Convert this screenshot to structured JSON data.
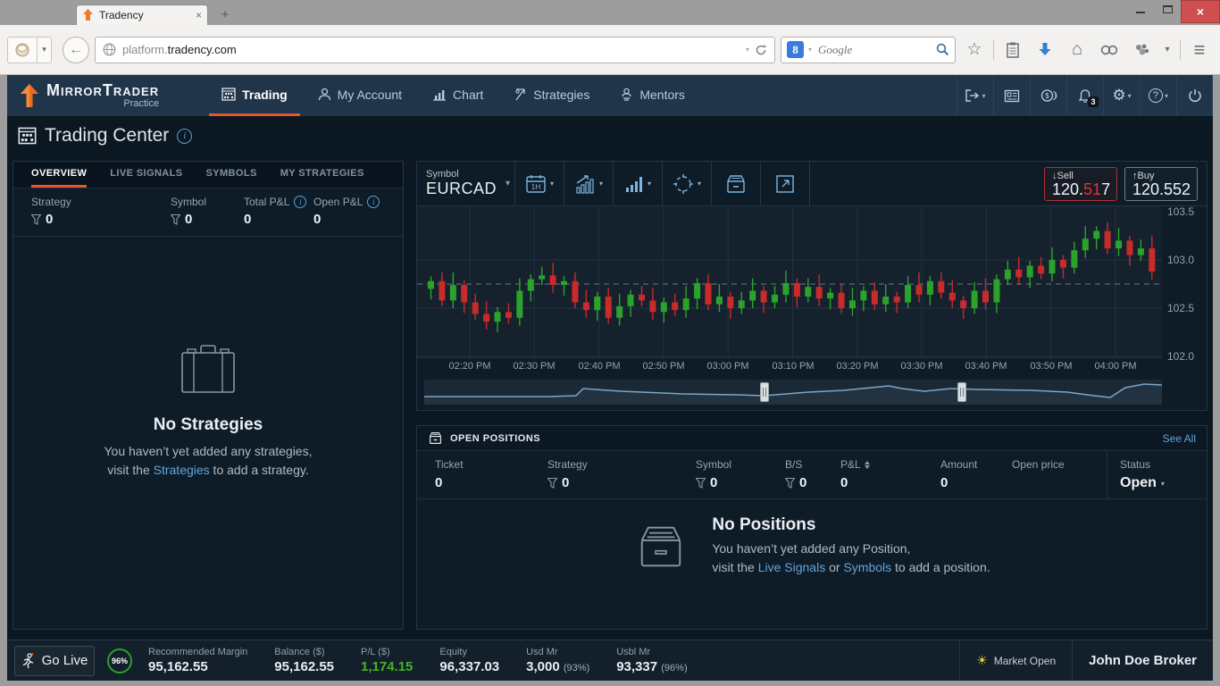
{
  "glyphs": {
    "dropdown": "▾",
    "plus": "+",
    "close_x": "×",
    "back_arrow": "←",
    "star": "☆",
    "home": "⌂",
    "gear": "⚙",
    "question": "?",
    "info": "i",
    "sun": "☀",
    "sell_arrow": "↓",
    "buy_arrow": "↑",
    "hamburger": "≡",
    "search_engine_initial": "8"
  },
  "browser": {
    "tab_title": "Tradency",
    "url_prefix": "platform.",
    "url_domain": "tradency.com",
    "search_placeholder": "Google"
  },
  "nav": {
    "brand": "MirrorTrader",
    "brand_sub": "Practice",
    "items": [
      {
        "label": "Trading"
      },
      {
        "label": "My Account"
      },
      {
        "label": "Chart"
      },
      {
        "label": "Strategies"
      },
      {
        "label": "Mentors"
      }
    ],
    "bell_badge": "3"
  },
  "page": {
    "title": "Trading Center"
  },
  "left_panel": {
    "tabs": [
      "OVERVIEW",
      "LIVE SIGNALS",
      "SYMBOLS",
      "MY STRATEGIES"
    ],
    "stats": [
      {
        "label": "Strategy",
        "value": "0"
      },
      {
        "label": "Symbol",
        "value": "0"
      },
      {
        "label": "Total P&L",
        "value": "0"
      },
      {
        "label": "Open P&L",
        "value": "0"
      }
    ],
    "empty": {
      "title": "No Strategies",
      "line1": "You haven’t yet added any strategies,",
      "line2_pre": "visit the ",
      "line2_link": "Strategies",
      "line2_post": " to add a strategy."
    }
  },
  "chart_panel": {
    "symbol_label": "Symbol",
    "symbol": "EURCAD",
    "timeframe": "1H",
    "sell": {
      "label": "Sell",
      "price_pre": "120.",
      "price_mid": "51",
      "price_post": "7"
    },
    "buy": {
      "label": "Buy",
      "price": "120.552"
    }
  },
  "chart_data": {
    "type": "candlestick",
    "symbol": "EURCAD",
    "timeframe": "1H",
    "ylim": [
      102.0,
      103.5
    ],
    "y_ticks": [
      "103.5",
      "103.0",
      "102.5",
      "102.0"
    ],
    "dashed_level": 102.75,
    "x_labels": [
      "02:20 PM",
      "02:30 PM",
      "02:40 PM",
      "02:50 PM",
      "03:00 PM",
      "03:10 PM",
      "03:20 PM",
      "03:30 PM",
      "03:40 PM",
      "03:50 PM",
      "04:00 PM"
    ],
    "candles": [
      [
        102.7,
        102.83,
        102.59,
        102.78
      ],
      [
        102.78,
        102.87,
        102.52,
        102.58
      ],
      [
        102.58,
        102.87,
        102.5,
        102.74
      ],
      [
        102.74,
        102.79,
        102.45,
        102.56
      ],
      [
        102.56,
        102.65,
        102.38,
        102.44
      ],
      [
        102.44,
        102.57,
        102.28,
        102.36
      ],
      [
        102.36,
        102.51,
        102.25,
        102.46
      ],
      [
        102.46,
        102.55,
        102.34,
        102.4
      ],
      [
        102.4,
        102.81,
        102.32,
        102.68
      ],
      [
        102.68,
        102.85,
        102.57,
        102.8
      ],
      [
        102.8,
        102.93,
        102.74,
        102.84
      ],
      [
        102.84,
        102.97,
        102.66,
        102.74
      ],
      [
        102.74,
        102.83,
        102.63,
        102.78
      ],
      [
        102.78,
        102.87,
        102.5,
        102.56
      ],
      [
        102.56,
        102.69,
        102.4,
        102.48
      ],
      [
        102.48,
        102.67,
        102.37,
        102.62
      ],
      [
        102.62,
        102.71,
        102.34,
        102.4
      ],
      [
        102.4,
        102.65,
        102.32,
        102.52
      ],
      [
        102.52,
        102.69,
        102.41,
        102.64
      ],
      [
        102.64,
        102.73,
        102.52,
        102.58
      ],
      [
        102.58,
        102.71,
        102.38,
        102.46
      ],
      [
        102.46,
        102.61,
        102.35,
        102.56
      ],
      [
        102.56,
        102.65,
        102.42,
        102.48
      ],
      [
        102.48,
        102.73,
        102.4,
        102.6
      ],
      [
        102.6,
        102.81,
        102.49,
        102.76
      ],
      [
        102.76,
        102.85,
        102.48,
        102.54
      ],
      [
        102.54,
        102.75,
        102.46,
        102.62
      ],
      [
        102.62,
        102.67,
        102.39,
        102.5
      ],
      [
        102.5,
        102.67,
        102.44,
        102.58
      ],
      [
        102.58,
        102.81,
        102.5,
        102.68
      ],
      [
        102.68,
        102.73,
        102.45,
        102.56
      ],
      [
        102.56,
        102.73,
        102.5,
        102.64
      ],
      [
        102.64,
        102.89,
        102.56,
        102.76
      ],
      [
        102.76,
        102.81,
        102.51,
        102.62
      ],
      [
        102.62,
        102.81,
        102.56,
        102.72
      ],
      [
        102.72,
        102.85,
        102.52,
        102.6
      ],
      [
        102.6,
        102.71,
        102.49,
        102.66
      ],
      [
        102.66,
        102.75,
        102.44,
        102.5
      ],
      [
        102.5,
        102.71,
        102.42,
        102.58
      ],
      [
        102.58,
        102.73,
        102.47,
        102.68
      ],
      [
        102.68,
        102.77,
        102.48,
        102.54
      ],
      [
        102.54,
        102.75,
        102.46,
        102.62
      ],
      [
        102.62,
        102.67,
        102.45,
        102.56
      ],
      [
        102.56,
        102.83,
        102.5,
        102.74
      ],
      [
        102.74,
        102.87,
        102.56,
        102.64
      ],
      [
        102.64,
        102.83,
        102.53,
        102.78
      ],
      [
        102.78,
        102.87,
        102.6,
        102.66
      ],
      [
        102.66,
        102.79,
        102.5,
        102.58
      ],
      [
        102.58,
        102.63,
        102.39,
        102.5
      ],
      [
        102.5,
        102.77,
        102.44,
        102.68
      ],
      [
        102.68,
        102.81,
        102.48,
        102.56
      ],
      [
        102.56,
        102.85,
        102.45,
        102.8
      ],
      [
        102.8,
        102.99,
        102.74,
        102.9
      ],
      [
        102.9,
        103.03,
        102.74,
        102.82
      ],
      [
        102.82,
        102.99,
        102.71,
        102.94
      ],
      [
        102.94,
        103.03,
        102.8,
        102.86
      ],
      [
        102.86,
        103.13,
        102.78,
        103.0
      ],
      [
        103.0,
        103.05,
        102.81,
        102.92
      ],
      [
        102.92,
        103.19,
        102.86,
        103.1
      ],
      [
        103.1,
        103.35,
        103.02,
        103.22
      ],
      [
        103.22,
        103.35,
        103.11,
        103.3
      ],
      [
        103.3,
        103.39,
        103.06,
        103.12
      ],
      [
        103.12,
        103.33,
        103.04,
        103.2
      ],
      [
        103.2,
        103.25,
        102.94,
        103.05
      ],
      [
        103.05,
        103.21,
        102.99,
        103.12
      ],
      [
        103.12,
        103.25,
        102.8,
        102.88
      ]
    ],
    "navigator": {
      "points": [
        [
          0,
          19
        ],
        [
          140,
          19
        ],
        [
          170,
          18
        ],
        [
          178,
          10
        ],
        [
          220,
          13
        ],
        [
          290,
          16
        ],
        [
          350,
          17
        ],
        [
          380,
          18
        ],
        [
          430,
          14
        ],
        [
          470,
          12
        ],
        [
          500,
          9
        ],
        [
          520,
          7
        ],
        [
          535,
          10
        ],
        [
          560,
          13
        ],
        [
          590,
          10
        ],
        [
          620,
          11
        ],
        [
          680,
          12
        ],
        [
          720,
          14
        ],
        [
          750,
          18
        ],
        [
          768,
          20
        ],
        [
          785,
          9
        ],
        [
          806,
          5
        ],
        [
          826,
          6
        ]
      ],
      "handles": [
        381,
        602
      ]
    }
  },
  "positions": {
    "title": "OPEN POSITIONS",
    "see_all": "See All",
    "columns": [
      {
        "label": "Ticket",
        "value": "0"
      },
      {
        "label": "Strategy",
        "value": "0"
      },
      {
        "label": "Symbol",
        "value": "0"
      },
      {
        "label": "B/S",
        "value": "0"
      },
      {
        "label": "P&L",
        "value": "0"
      },
      {
        "label": "Amount",
        "value": "0"
      },
      {
        "label": "Open price",
        "value": ""
      }
    ],
    "status": {
      "label": "Status",
      "value": "Open"
    },
    "empty": {
      "title": "No Positions",
      "line1": "You haven’t yet added any Position,",
      "line2_pre": "visit the ",
      "link1": "Live Signals",
      "mid": " or ",
      "link2": "Symbols",
      "post": " to add a position."
    }
  },
  "footer": {
    "go_live": "Go Live",
    "gauge": "96%",
    "stats": [
      {
        "label": "Recommended Margin",
        "value": "95,162.55"
      },
      {
        "label": "Balance ($)",
        "value": "95,162.55"
      },
      {
        "label": "P/L ($)",
        "value": "1,174.15"
      },
      {
        "label": "Equity",
        "value": "96,337.03"
      },
      {
        "label": "Usd Mr",
        "value": "3,000",
        "sub": "(93%)"
      },
      {
        "label": "Usbl Mr",
        "value": "93,337",
        "sub": "(96%)"
      }
    ],
    "market_status": "Market Open",
    "broker": "John Doe Broker"
  },
  "colors": {
    "accent_orange": "#e8542c",
    "candle_up": "#2ba32b",
    "candle_down": "#c92a2a",
    "link_blue": "#62a4da",
    "profit_green": "#46b324",
    "sell_red": "#e03434",
    "navbar": "#20344a",
    "page_bg": "#0b1822",
    "plot_bg": "#15222e"
  }
}
